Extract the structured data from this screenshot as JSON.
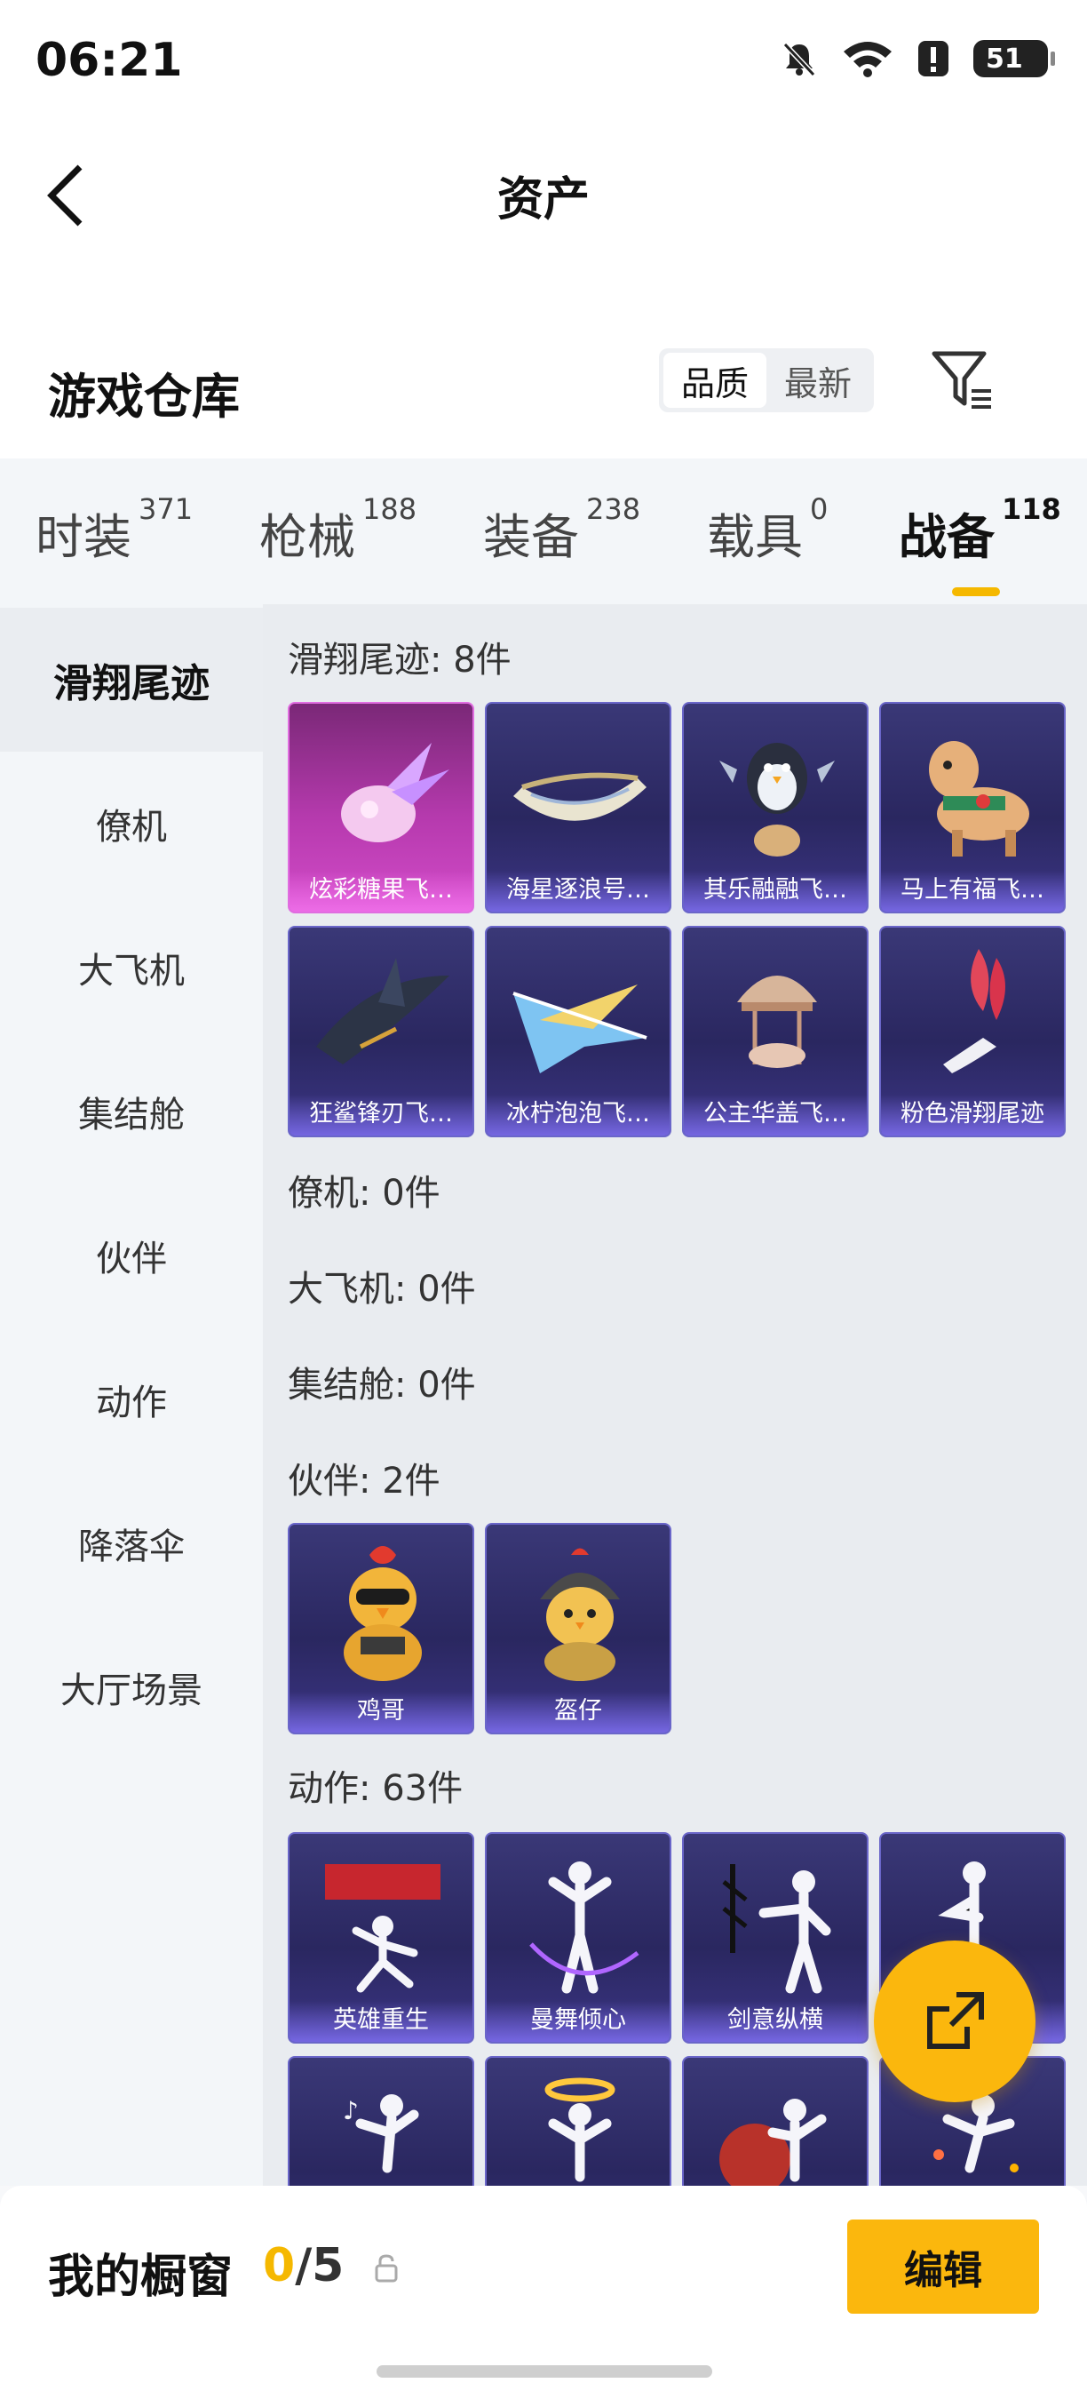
{
  "status": {
    "time": "06:21",
    "battery": "51"
  },
  "header": {
    "title": "资产"
  },
  "warehouse": {
    "title": "游戏仓库",
    "sort_options": [
      "品质",
      "最新"
    ],
    "active_sort": "品质"
  },
  "tabs": [
    {
      "label": "时装",
      "count": "371"
    },
    {
      "label": "枪械",
      "count": "188"
    },
    {
      "label": "装备",
      "count": "238"
    },
    {
      "label": "载具",
      "count": "0"
    },
    {
      "label": "战备",
      "count": "118"
    }
  ],
  "active_tab": "战备",
  "sidebar": [
    {
      "label": "滑翔尾迹"
    },
    {
      "label": "僚机"
    },
    {
      "label": "大飞机"
    },
    {
      "label": "集结舱"
    },
    {
      "label": "伙伴"
    },
    {
      "label": "动作"
    },
    {
      "label": "降落伞"
    },
    {
      "label": "大厅场景"
    }
  ],
  "sections": {
    "glide": {
      "title": "滑翔尾迹: 8件",
      "items": [
        "炫彩糖果飞…",
        "海星逐浪号…",
        "其乐融融飞…",
        "马上有福飞…",
        "狂鲨锋刃飞…",
        "冰柠泡泡飞…",
        "公主华盖飞…",
        "粉色滑翔尾迹"
      ]
    },
    "wingman": {
      "title": "僚机: 0件"
    },
    "plane": {
      "title": "大飞机: 0件"
    },
    "pod": {
      "title": "集结舱: 0件"
    },
    "partner": {
      "title": "伙伴: 2件",
      "items": [
        "鸡哥",
        "盔仔"
      ]
    },
    "emote": {
      "title": "动作: 63件",
      "items": [
        "英雄重生",
        "曼舞倾心",
        "剑意纵横",
        "",
        "",
        "",
        "",
        ""
      ]
    }
  },
  "bottom": {
    "showcase_label": "我的橱窗",
    "current": "0",
    "total": "/5",
    "edit_label": "编辑"
  },
  "colors": {
    "accent": "#fbb70d",
    "card_bg": "#2a2760",
    "card_pink": "#b63aae"
  }
}
